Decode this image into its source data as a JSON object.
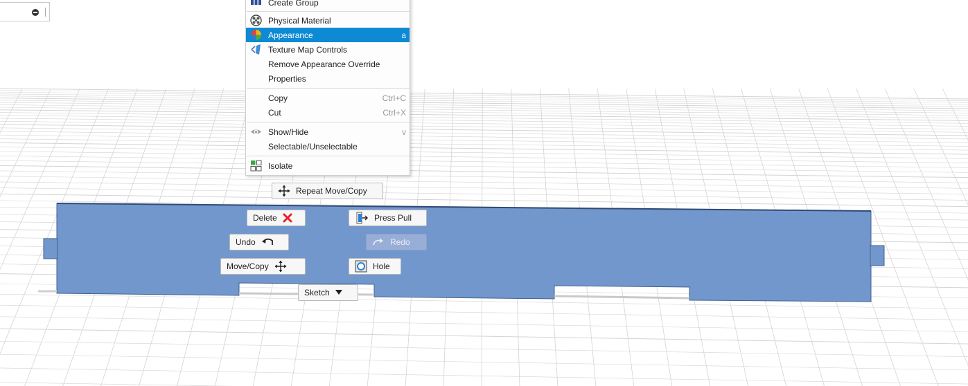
{
  "context_menu": {
    "items": [
      {
        "label": "Create Group",
        "shortcut": "",
        "icon": "create-group-icon"
      },
      {
        "label": "Physical Material",
        "shortcut": "",
        "icon": "physical-material-icon"
      },
      {
        "label": "Appearance",
        "shortcut": "a",
        "icon": "appearance-icon",
        "highlighted": true
      },
      {
        "label": "Texture Map Controls",
        "shortcut": "",
        "icon": "texture-map-icon"
      },
      {
        "label": "Remove Appearance Override",
        "shortcut": ""
      },
      {
        "label": "Properties",
        "shortcut": ""
      },
      {
        "label": "Copy",
        "shortcut": "Ctrl+C"
      },
      {
        "label": "Cut",
        "shortcut": "Ctrl+X"
      },
      {
        "label": "Show/Hide",
        "shortcut": "v",
        "icon": "eye-icon"
      },
      {
        "label": "Selectable/Unselectable",
        "shortcut": ""
      },
      {
        "label": "Isolate",
        "shortcut": "",
        "icon": "isolate-icon"
      }
    ]
  },
  "marking_menu": {
    "repeat": "Repeat Move/Copy",
    "delete": "Delete",
    "press_pull": "Press Pull",
    "undo": "Undo",
    "redo": "Redo",
    "move_copy": "Move/Copy",
    "hole": "Hole",
    "sketch": "Sketch"
  },
  "colors": {
    "highlight": "#0e8ad4",
    "body_fill": "#7297cc",
    "grid_line": "#d4d4d4",
    "delete_icon": "#e8232b"
  }
}
